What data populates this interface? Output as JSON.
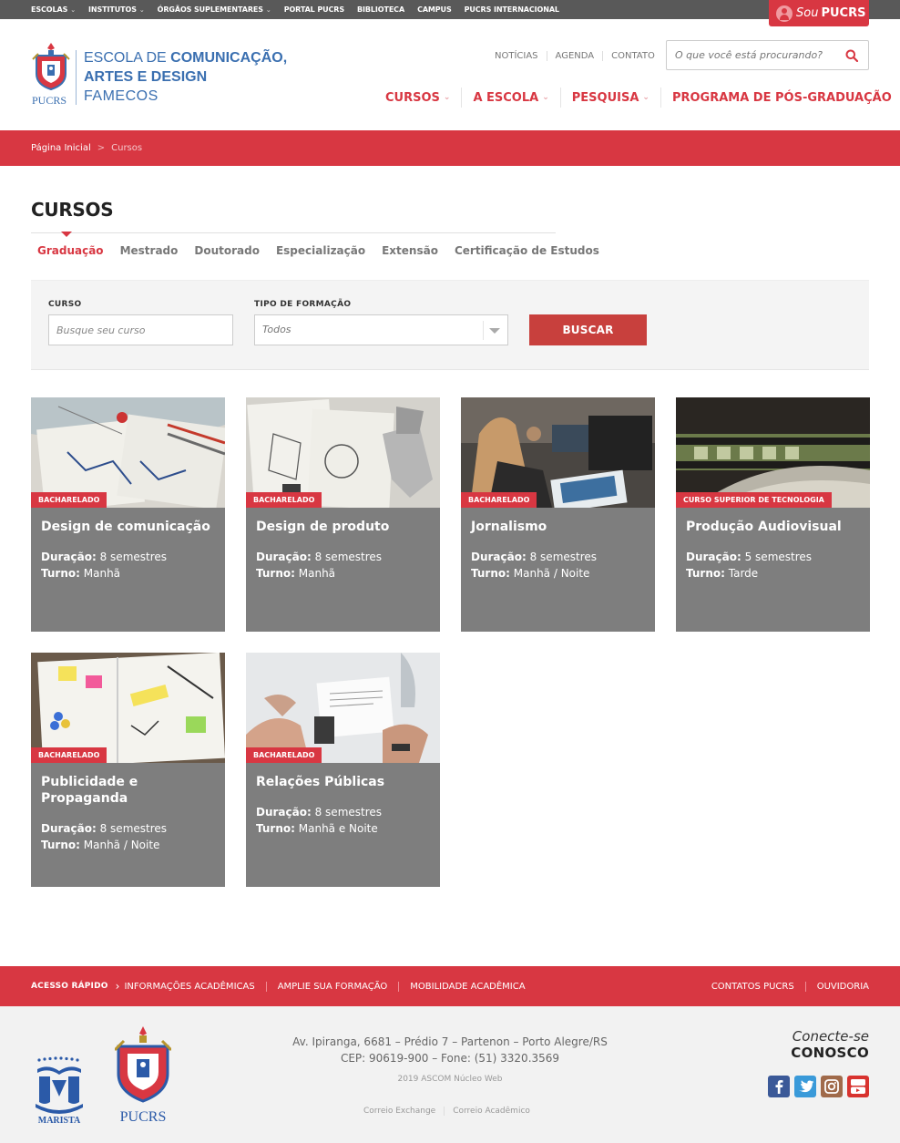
{
  "topbar": {
    "links": [
      "ESCOLAS",
      "INSTITUTOS",
      "ÓRGÃOS SUPLEMENTARES",
      "PORTAL PUCRS",
      "BIBLIOTECA",
      "CAMPUS",
      "PUCRS INTERNACIONAL"
    ],
    "sou_a": "Sou",
    "sou_b": "PUCRS"
  },
  "header": {
    "school_line1a": "ESCOLA DE ",
    "school_line1b": "COMUNICAÇÃO,",
    "school_line2": "ARTES E DESIGN",
    "school_line3": "FAMECOS",
    "pucrs_label": "PUCRS",
    "utility": [
      "NOTÍCIAS",
      "AGENDA",
      "CONTATO"
    ],
    "search_placeholder": "O que você está procurando?",
    "nav": [
      "CURSOS",
      "A ESCOLA",
      "PESQUISA",
      "PROGRAMA DE PÓS-GRADUAÇÃO"
    ]
  },
  "breadcrumb": {
    "home": "Página Inicial",
    "sep": ">",
    "current": "Cursos"
  },
  "page": {
    "title": "CURSOS",
    "tabs": [
      "Graduação",
      "Mestrado",
      "Doutorado",
      "Especialização",
      "Extensão",
      "Certificação de Estudos"
    ]
  },
  "filter": {
    "curso_label": "CURSO",
    "curso_placeholder": "Busque seu curso",
    "tipo_label": "TIPO DE FORMAÇÃO",
    "tipo_value": "Todos",
    "button": "BUSCAR"
  },
  "labels": {
    "duracao": "Duração:",
    "turno": "Turno:"
  },
  "courses": [
    {
      "badge": "BACHARELADO",
      "title": "Design de comunicação",
      "duracao": "8 semestres",
      "turno": "Manhã"
    },
    {
      "badge": "BACHARELADO",
      "title": "Design de produto",
      "duracao": "8 semestres",
      "turno": "Manhã"
    },
    {
      "badge": "BACHARELADO",
      "title": "Jornalismo",
      "duracao": "8 semestres",
      "turno": "Manhã / Noite"
    },
    {
      "badge": "CURSO SUPERIOR DE TECNOLOGIA",
      "title": "Produção Audiovisual",
      "duracao": "5 semestres",
      "turno": "Tarde"
    },
    {
      "badge": "BACHARELADO",
      "title": "Publicidade e Propaganda",
      "duracao": "8 semestres",
      "turno": "Manhã / Noite"
    },
    {
      "badge": "BACHARELADO",
      "title": "Relações Públicas",
      "duracao": "8 semestres",
      "turno": "Manhã e Noite"
    }
  ],
  "footer": {
    "acesso": "ACESSO RÁPIDO",
    "quick_links": [
      "INFORMAÇÕES ACADÊMICAS",
      "AMPLIE SUA FORMAÇÃO",
      "MOBILIDADE ACADÊMICA"
    ],
    "right_links": [
      "CONTATOS PUCRS",
      "OUVIDORIA"
    ],
    "address1": "Av. Ipiranga, 6681 – Prédio 7 – Partenon – Porto Alegre/RS",
    "address2": "CEP: 90619-900 – Fone: (51) 3320.3569",
    "copyright": "2019 ASCOM Núcleo Web",
    "mail": [
      "Correio Exchange",
      "Correio Acadêmico"
    ],
    "connect_a": "Conecte-se",
    "connect_b": "CONOSCO",
    "marista": "MARISTA",
    "pucrs": "PUCRS",
    "social": [
      "facebook-icon",
      "twitter-icon",
      "instagram-icon",
      "youtube-icon"
    ]
  },
  "colors": {
    "brand_red": "#d83742",
    "brand_blue": "#3a6fb0",
    "card_gray": "#7e7e7e",
    "topbar": "#595959"
  }
}
